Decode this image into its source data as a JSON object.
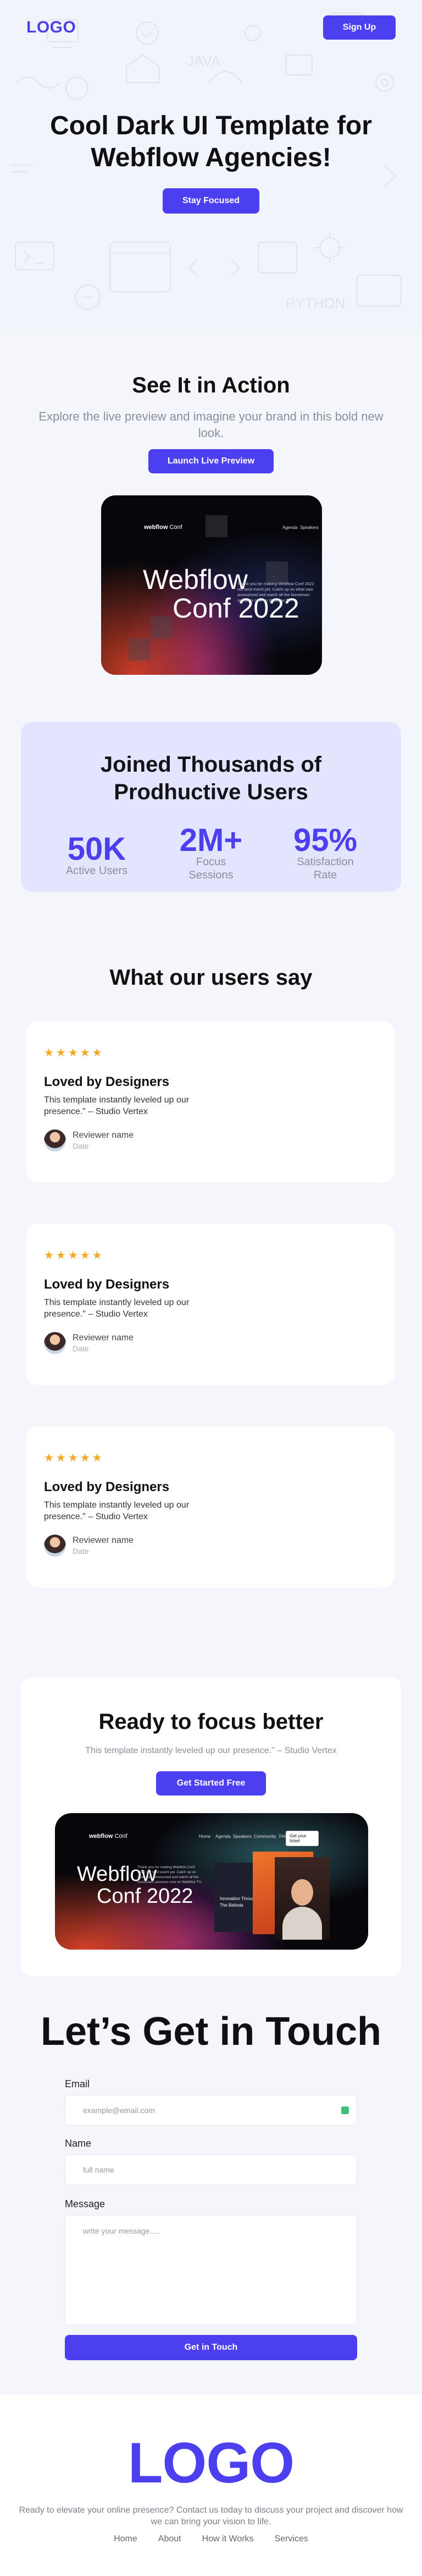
{
  "header": {
    "logo": "LOGO",
    "signup_label": "Sign Up"
  },
  "hero": {
    "title_line1": "Cool Dark UI Template for",
    "title_line2": "Webflow Agencies!",
    "button_label": "Stay Focused",
    "pattern_words": [
      "JAVA",
      "PYTHON"
    ]
  },
  "action": {
    "title": "See It in Action",
    "subtitle": "Explore the live preview and imagine your brand in this bold new look.",
    "button_label": "Launch Live Preview",
    "mockup": {
      "brand_bold": "webflow",
      "brand_light": "Conf",
      "nav": [
        "Agenda",
        "Speakers"
      ],
      "headline_line1": "Webflow",
      "headline_line2": "Conf 2022",
      "blurb": "Thank you for making Webflow Conf 2022 our best event yet. Catch up on what was announced and watch all the livestream sessions now on Webflow TV."
    }
  },
  "stats": {
    "title_line1": "Joined Thousands of",
    "title_line2": "Prodhuctive Users",
    "items": [
      {
        "value": "50K",
        "label_line1": "Active Users",
        "label_line2": ""
      },
      {
        "value": "2M+",
        "label_line1": "Focus",
        "label_line2": "Sessions"
      },
      {
        "value": "95%",
        "label_line1": "Satisfaction",
        "label_line2": "Rate"
      }
    ]
  },
  "testimonials": {
    "title": "What our users say",
    "items": [
      {
        "stars": "★★★★★",
        "title": "Loved by Designers",
        "quote": "This template instantly leveled up our presence.\" – Studio Vertex",
        "name": "Reviewer name",
        "date": "Date"
      },
      {
        "stars": "★★★★★",
        "title": "Loved by Designers",
        "quote": "This template instantly leveled up our presence.\" – Studio Vertex",
        "name": "Reviewer name",
        "date": "Date"
      },
      {
        "stars": "★★★★★",
        "title": "Loved by Designers",
        "quote": "This template instantly leveled up our presence.\" – Studio Vertex",
        "name": "Reviewer name",
        "date": "Date"
      }
    ]
  },
  "focus": {
    "title": "Ready to focus better",
    "subtitle": "This template instantly leveled up our presence.\" – Studio Vertex",
    "button_label": "Get Started Free",
    "mockup": {
      "brand_bold": "webflow",
      "brand_light": "Conf",
      "nav": [
        "Home",
        "Agenda",
        "Speakers",
        "Community",
        "FAQ"
      ],
      "cta": "Get your ticket",
      "headline_line1": "Webflow",
      "headline_line2": "Conf 2022",
      "card_title_line1": "Innovation Through",
      "card_title_line2": "The Belinda",
      "blurb": "Thank you for making Webflow Conf 2022 our best event yet. Catch up on what was announced and watch all the livestream sessions now on Webflow TV."
    }
  },
  "contact": {
    "title": "Let’s Get in Touch",
    "email_label": "Email",
    "email_placeholder": "example@email.com",
    "name_label": "Name",
    "name_placeholder": "full name",
    "message_label": "Message",
    "message_placeholder": "write your message.....",
    "submit_label": "Get in Touch"
  },
  "footer": {
    "logo": "LOGO",
    "text": "Ready to elevate your online presence? Contact us today to discuss your project and discover how we can bring your vision to life.",
    "links": [
      "Home",
      "About",
      "How it Works",
      "Services"
    ]
  },
  "colors": {
    "accent": "#4b3ff0",
    "page_bg": "#f4f6fc",
    "stats_bg": "#e3e4fd",
    "stars": "#f5a623"
  }
}
